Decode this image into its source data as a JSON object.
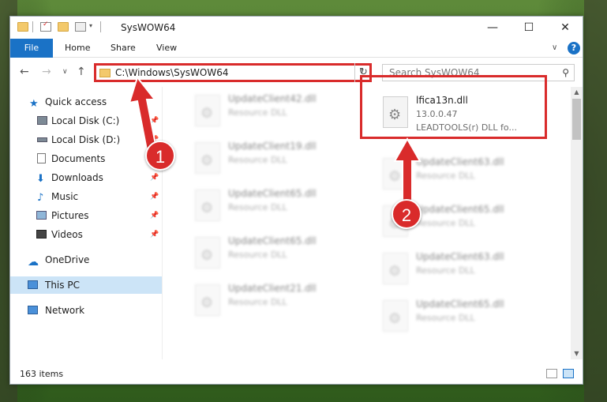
{
  "window": {
    "title": "SysWOW64"
  },
  "ribbon": {
    "file": "File",
    "home": "Home",
    "share": "Share",
    "view": "View"
  },
  "address": {
    "path": "C:\\Windows\\SysWOW64",
    "search_placeholder": "Search SysWOW64"
  },
  "sidebar": {
    "items": [
      {
        "label": "Quick access",
        "icon": "star-icon"
      },
      {
        "label": "Local Disk (C:)",
        "icon": "drive-icon"
      },
      {
        "label": "Local Disk (D:)",
        "icon": "drive-icon"
      },
      {
        "label": "Documents",
        "icon": "documents-icon"
      },
      {
        "label": "Downloads",
        "icon": "download-icon"
      },
      {
        "label": "Music",
        "icon": "music-icon"
      },
      {
        "label": "Pictures",
        "icon": "pictures-icon"
      },
      {
        "label": "Videos",
        "icon": "videos-icon"
      },
      {
        "label": "OneDrive",
        "icon": "cloud-icon"
      },
      {
        "label": "This PC",
        "icon": "pc-icon"
      },
      {
        "label": "Network",
        "icon": "network-icon"
      }
    ]
  },
  "files": {
    "left": [
      {
        "name": "UpdateClient42.dll",
        "type": "Resource DLL"
      },
      {
        "name": "UpdateClient19.dll",
        "type": "Resource DLL"
      },
      {
        "name": "UpdateClient65.dll",
        "type": "Resource DLL"
      },
      {
        "name": "UpdateClient65.dll",
        "type": "Resource DLL"
      },
      {
        "name": "UpdateClient21.dll",
        "type": "Resource DLL"
      }
    ],
    "right": [
      {
        "name": "UpdateClient63.dll",
        "type": "Resource DLL"
      },
      {
        "name": "UpdateClient65.dll",
        "type": "Resource DLL"
      },
      {
        "name": "UpdateClient63.dll",
        "type": "Resource DLL"
      },
      {
        "name": "UpdateClient65.dll",
        "type": "Resource DLL"
      }
    ],
    "highlighted": {
      "name": "lfica13n.dll",
      "version": "13.0.0.47",
      "description": "LEADTOOLS(r) DLL fo..."
    }
  },
  "status": {
    "item_count": "163 items"
  },
  "annotations": {
    "step1": "1",
    "step2": "2"
  },
  "colors": {
    "accent": "#1a72c6",
    "highlight": "#d92b2b",
    "selection": "#cce4f7"
  }
}
